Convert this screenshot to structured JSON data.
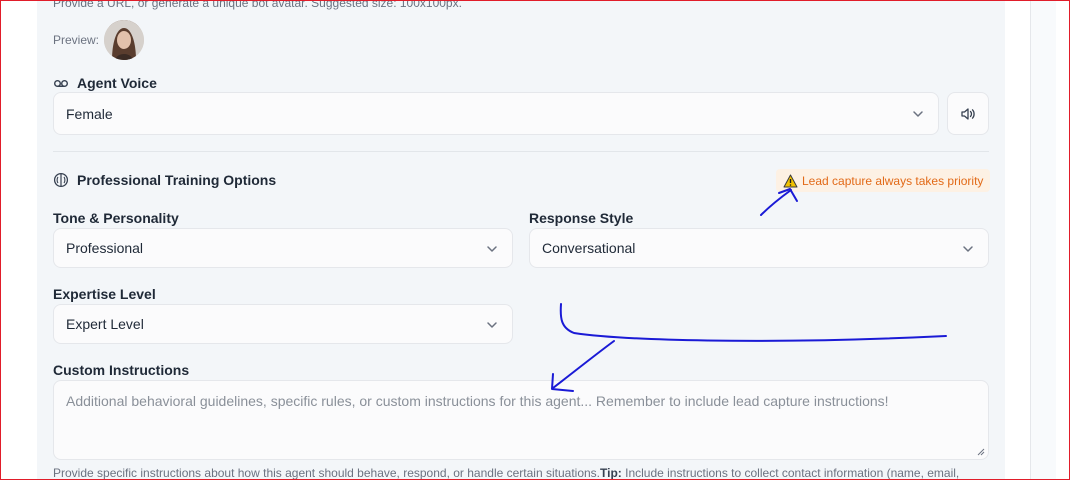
{
  "avatar": {
    "helptext": "Provide a URL, or generate a unique bot avatar. Suggested size: 100x100px.",
    "preview_label": "Preview:"
  },
  "voice": {
    "section_title": "Agent Voice",
    "icon": "voicemail-icon",
    "selected": "Female",
    "play_icon": "speaker-icon"
  },
  "training": {
    "section_title": "Professional Training Options",
    "icon": "brain-icon",
    "badge": {
      "icon": "warning-icon",
      "text": "Lead capture always takes priority"
    },
    "tone": {
      "label": "Tone & Personality",
      "selected": "Professional"
    },
    "response_style": {
      "label": "Response Style",
      "selected": "Conversational"
    },
    "expertise": {
      "label": "Expertise Level",
      "selected": "Expert Level"
    },
    "custom_instructions": {
      "label": "Custom Instructions",
      "placeholder": "Additional behavioral guidelines, specific rules, or custom instructions for this agent... Remember to include lead capture instructions!",
      "helptext_start": "Provide specific instructions about how this agent should behave, respond, or handle certain situations.",
      "helptext_tip_label": "Tip:",
      "helptext_end": " Include instructions to collect contact information (name, email,"
    }
  },
  "colors": {
    "panel_bg": "#f3f6f9",
    "badge_bg": "#fdf1e4",
    "badge_text": "#e26a18",
    "annotation_ink": "#1a1ad6",
    "frame_border": "#e11d2a"
  }
}
